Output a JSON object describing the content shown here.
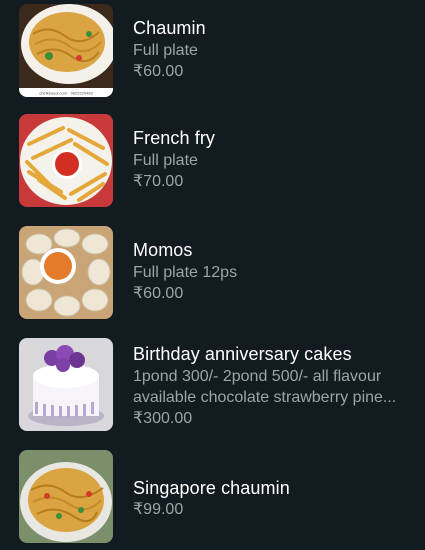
{
  "items": [
    {
      "name": "Chaumin",
      "description": "Full plate",
      "price": "₹60.00",
      "watermark": "chefkirasoi.com · 9825220483"
    },
    {
      "name": "French fry",
      "description": "Full plate",
      "price": "₹70.00"
    },
    {
      "name": "Momos",
      "description": "Full plate 12ps",
      "price": "₹60.00"
    },
    {
      "name": "Birthday anniversary cakes",
      "description": "1pond 300/-   2pond 500/- all flavour available chocolate strawberry pine...",
      "price": "₹300.00"
    },
    {
      "name": "Singapore chaumin",
      "description": "",
      "price": "₹99.00"
    }
  ],
  "colors": {
    "background": "#121b20",
    "title": "#ffffff",
    "secondary": "#9aa4ab"
  }
}
